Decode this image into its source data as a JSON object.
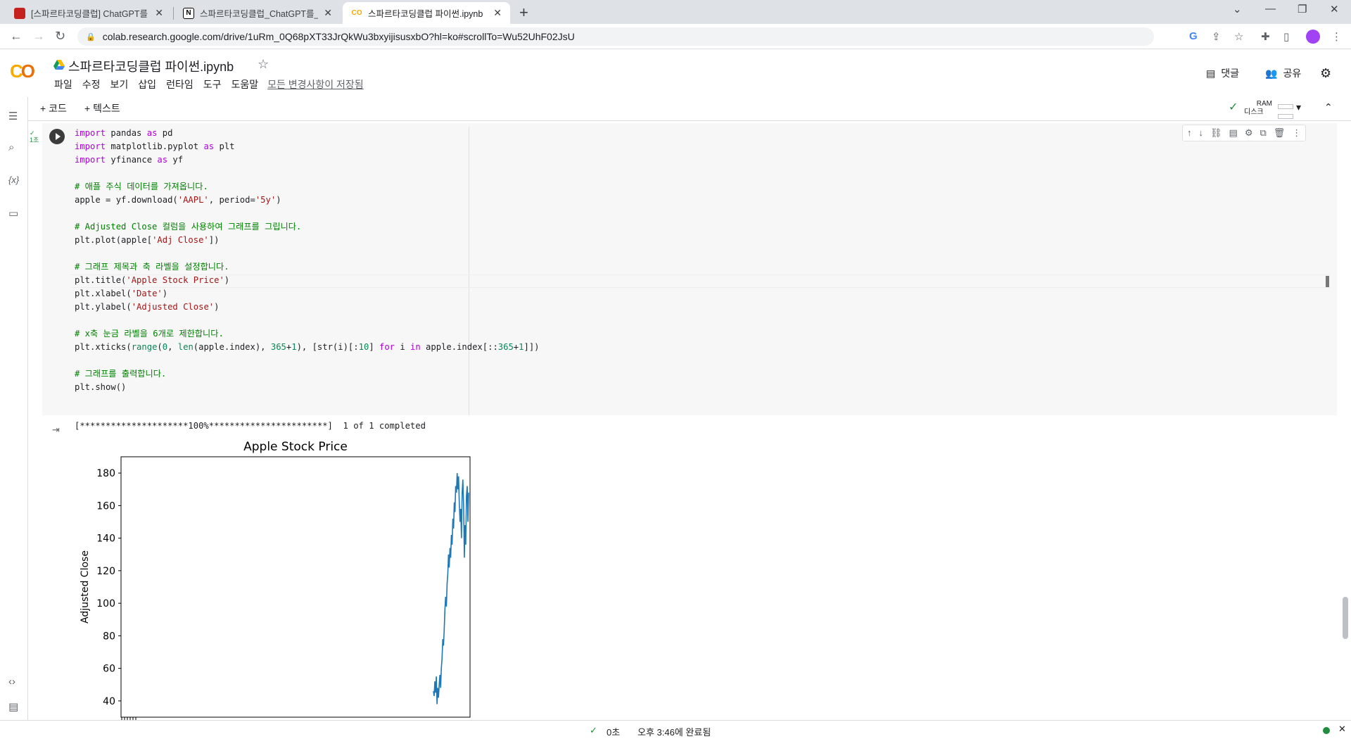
{
  "browser": {
    "tabs": [
      {
        "title": "[스파르타코딩클럽] ChatGPT를",
        "favicon": "red-square-icon"
      },
      {
        "title": "스파르타코딩클럽_ChatGPT를_",
        "favicon": "notion-icon"
      },
      {
        "title": "스파르타코딩클럽 파이썬.ipynb",
        "favicon": "colab-icon"
      }
    ],
    "url": "colab.research.google.com/drive/1uRm_0Q68pXT33JrQkWu3bxyijisusxbO?hl=ko#scrollTo=Wu52UhF02JsU"
  },
  "colab": {
    "logo": "CO",
    "title": "스파르타코딩클럽 파이썬.ipynb",
    "menu": [
      "파일",
      "수정",
      "보기",
      "삽입",
      "런타임",
      "도구",
      "도움말"
    ],
    "saved_status": "모든 변경사항이 저장됨",
    "comment_label": "댓글",
    "share_label": "공유",
    "add_code": "+ 코드",
    "add_text": "+ 텍스트",
    "ram_label": "RAM",
    "disk_label": "디스크",
    "exec_time": "1초"
  },
  "code": [
    {
      "parts": [
        [
          "kw",
          "import"
        ],
        [
          "t",
          " pandas "
        ],
        [
          "kw",
          "as"
        ],
        [
          "t",
          " pd"
        ]
      ]
    },
    {
      "parts": [
        [
          "kw",
          "import"
        ],
        [
          "t",
          " matplotlib.pyplot "
        ],
        [
          "kw",
          "as"
        ],
        [
          "t",
          " plt"
        ]
      ]
    },
    {
      "parts": [
        [
          "kw",
          "import"
        ],
        [
          "t",
          " yfinance "
        ],
        [
          "kw",
          "as"
        ],
        [
          "t",
          " yf"
        ]
      ]
    },
    {
      "parts": []
    },
    {
      "parts": [
        [
          "cm",
          "# 애플 주식 데이터를 가져옵니다."
        ]
      ]
    },
    {
      "parts": [
        [
          "t",
          "apple = yf.download("
        ],
        [
          "str",
          "'AAPL'"
        ],
        [
          "t",
          ", period="
        ],
        [
          "str",
          "'5y'"
        ],
        [
          "t",
          ")"
        ]
      ]
    },
    {
      "parts": []
    },
    {
      "parts": [
        [
          "cm",
          "# Adjusted Close 컬럼을 사용하여 그래프를 그립니다."
        ]
      ]
    },
    {
      "parts": [
        [
          "t",
          "plt.plot(apple["
        ],
        [
          "str",
          "'Adj Close'"
        ],
        [
          "t",
          "])"
        ]
      ]
    },
    {
      "parts": []
    },
    {
      "parts": [
        [
          "cm",
          "# 그래프 제목과 축 라벨을 설정합니다."
        ]
      ]
    },
    {
      "parts": [
        [
          "t",
          "plt.title("
        ],
        [
          "str",
          "'Apple Stock Price'"
        ],
        [
          "t",
          ")"
        ]
      ]
    },
    {
      "parts": [
        [
          "t",
          "plt.xlabel("
        ],
        [
          "str",
          "'Date'"
        ],
        [
          "t",
          ")"
        ]
      ]
    },
    {
      "parts": [
        [
          "t",
          "plt.ylabel("
        ],
        [
          "str",
          "'Adjusted Close'"
        ],
        [
          "t",
          ")"
        ]
      ]
    },
    {
      "parts": []
    },
    {
      "parts": [
        [
          "cm",
          "# x축 눈금 라벨을 6개로 제한합니다."
        ]
      ]
    },
    {
      "parts": [
        [
          "t",
          "plt.xticks("
        ],
        [
          "num",
          "range"
        ],
        [
          "t",
          "("
        ],
        [
          "num",
          "0"
        ],
        [
          "t",
          ", "
        ],
        [
          "num",
          "len"
        ],
        [
          "t",
          "(apple.index), "
        ],
        [
          "num",
          "365"
        ],
        [
          "t",
          "+"
        ],
        [
          "num",
          "1"
        ],
        [
          "t",
          "), [str(i)[:"
        ],
        [
          "num",
          "10"
        ],
        [
          "t",
          "] "
        ],
        [
          "kw",
          "for"
        ],
        [
          "t",
          " i "
        ],
        [
          "kw",
          "in"
        ],
        [
          "t",
          " apple.index[::"
        ],
        [
          "num",
          "365"
        ],
        [
          "t",
          "+"
        ],
        [
          "num",
          "1"
        ],
        [
          "t",
          "]])"
        ]
      ]
    },
    {
      "parts": []
    },
    {
      "parts": [
        [
          "cm",
          "# 그래프를 출력합니다."
        ]
      ]
    },
    {
      "parts": [
        [
          "t",
          "plt.show()"
        ]
      ]
    }
  ],
  "output": {
    "progress": "[*********************100%***********************]  1 of 1 completed"
  },
  "chart_data": {
    "type": "line",
    "title": "Apple Stock Price",
    "xlabel": "",
    "ylabel": "Adjusted Close",
    "ylim": [
      30,
      190
    ],
    "yticks": [
      40,
      60,
      80,
      100,
      120,
      140,
      160,
      180
    ],
    "line_color": "#1f77b4",
    "series": [
      {
        "values": [
          46,
          43,
          52,
          45,
          55,
          38,
          48,
          42,
          50,
          56,
          48,
          60,
          66,
          78,
          74,
          84,
          96,
          104,
          98,
          112,
          118,
          130,
          122,
          134,
          128,
          142,
          136,
          152,
          146,
          162,
          156,
          172,
          168,
          180,
          170,
          178,
          162,
          150,
          158,
          140,
          168,
          176,
          160,
          128,
          148,
          136,
          166,
          172,
          150,
          168
        ]
      }
    ]
  },
  "status": {
    "time_used": "0초",
    "completed_at": "오후 3:46에 완료됨"
  }
}
